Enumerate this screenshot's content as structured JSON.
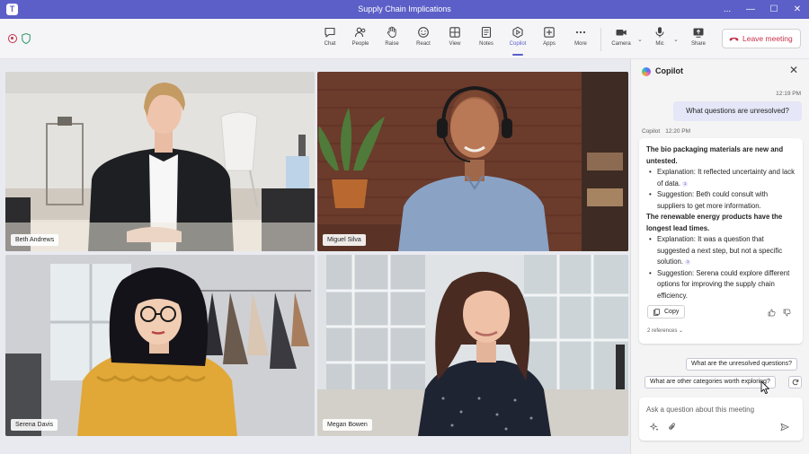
{
  "window": {
    "title": "Supply Chain Implications",
    "controls": [
      "...",
      "—",
      "☐",
      "✕"
    ]
  },
  "toolbar": {
    "items": [
      {
        "id": "chat",
        "label": "Chat",
        "icon": "chat-icon"
      },
      {
        "id": "people",
        "label": "People",
        "icon": "people-icon"
      },
      {
        "id": "raise",
        "label": "Raise",
        "icon": "raise-hand-icon"
      },
      {
        "id": "react",
        "label": "React",
        "icon": "react-smiley-icon"
      },
      {
        "id": "view",
        "label": "View",
        "icon": "view-grid-icon"
      },
      {
        "id": "notes",
        "label": "Notes",
        "icon": "notes-icon"
      },
      {
        "id": "copilot",
        "label": "Copilot",
        "icon": "copilot-icon",
        "active": true
      },
      {
        "id": "apps",
        "label": "Apps",
        "icon": "apps-plus-icon"
      },
      {
        "id": "more",
        "label": "More",
        "icon": "more-dots-icon"
      },
      {
        "id": "camera",
        "label": "Camera",
        "icon": "camera-icon"
      },
      {
        "id": "mic",
        "label": "Mic",
        "icon": "mic-icon"
      },
      {
        "id": "share",
        "label": "Share",
        "icon": "share-screen-icon"
      }
    ],
    "leave_label": "Leave meeting",
    "accent": "#5b5fc7",
    "leave_color": "#c4314b"
  },
  "participants": [
    {
      "name": "Beth Andrews"
    },
    {
      "name": "Miguel Silva"
    },
    {
      "name": "Serena Davis"
    },
    {
      "name": "Megan Bowen"
    }
  ],
  "copilot": {
    "title": "Copilot",
    "user_time": "12:19 PM",
    "user_question": "What questions are unresolved?",
    "author": "Copilot",
    "answer_time": "12:20 PM",
    "answer": {
      "h1": "The bio packaging materials are new and untested.",
      "h1_bullets": [
        "Explanation: It reflected uncertainty and lack of data.",
        "Suggestion: Beth could consult with suppliers to get more information."
      ],
      "h2": "The renewable energy products have the longest lead times.",
      "h2_bullets": [
        "Explanation: It was a question that suggested a next step, but not a specific solution.",
        "Suggestion: Serena could explore different options for improving the supply chain efficiency."
      ],
      "citation_marker": "1"
    },
    "copy_label": "Copy",
    "references_label": "2 references",
    "suggestions": [
      "What are the unresolved questions?",
      "What are other categories worth exploring?"
    ],
    "compose_placeholder": "Ask a question about this meeting"
  }
}
